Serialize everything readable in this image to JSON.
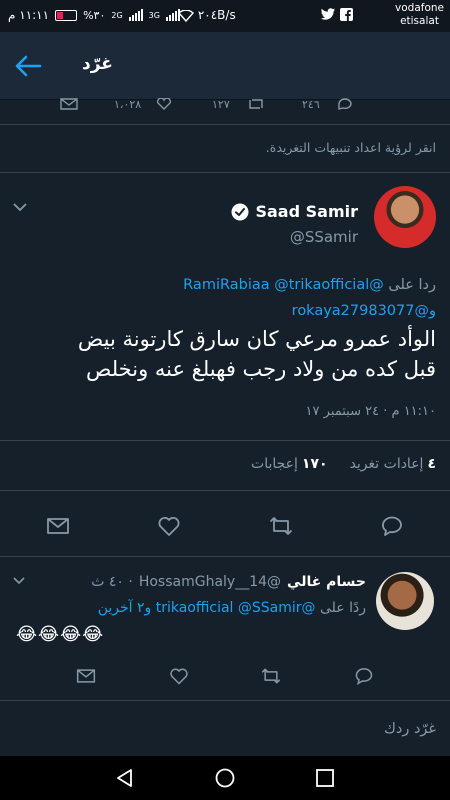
{
  "status_bar": {
    "time": "١١:١١ م",
    "battery_pct": "%٣٠",
    "net_2g": "2G",
    "net_3g": "3G",
    "speed": "٢٠٤B/s",
    "carrier_line1": "vodafone",
    "carrier_line2": "etisalat"
  },
  "header": {
    "title": "غرّد"
  },
  "top_strip": {
    "likes": "١،٠٢٨",
    "retweets": "١٢٧",
    "replies": "٢٤٦"
  },
  "notify_hint": "انقر لرؤية اعداد تنبيهات التغريدة.",
  "main_tweet": {
    "display_name": "Saad Samir",
    "handle": "@SSamir",
    "reply_prefix": "ردا على",
    "reply_mention_1": "@RamiRabiaa",
    "reply_mention_2": "@trikaofficial",
    "reply_and": "و",
    "reply_mention_3": "@rokaya27983077",
    "text_line_1": "الوأد عمرو مرعي كان سارق كارتونة بيض",
    "text_line_2": "قبل كده من ولاد رجب فهبلغ عنه ونخلص",
    "timestamp": "١١:١٠ م · ٢٤ سبتمبر ١٧",
    "retweets_count": "٤",
    "retweets_label": "إعادات تغريد",
    "likes_count": "١٧٠",
    "likes_label": "إعجابات"
  },
  "reply_tweet": {
    "display_name": "حسام غالي",
    "handle": "@HossamGhaly__14",
    "time": "٤٠ ث",
    "reply_prefix": "ردًا على",
    "mention_1": "@trikaofficial",
    "mention_2": "@SSamir",
    "and_others": "و٢ آخرين",
    "body": "😂😂😂😂"
  },
  "compose": {
    "placeholder": "غرّد ردك"
  }
}
